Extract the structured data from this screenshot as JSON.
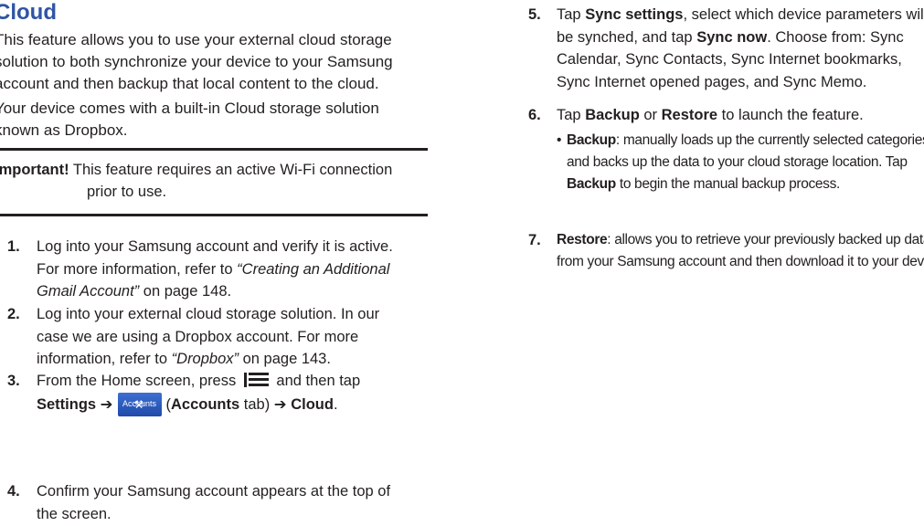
{
  "left": {
    "title": "Cloud",
    "intro_lines": [
      "This feature allows you to use your external cloud storage",
      "solution to both synchronize your device to your Samsung",
      "account and then backup that local content to the cloud."
    ],
    "dropbox_lines": [
      "Your device comes with a built-in Cloud storage solution",
      "known as Dropbox."
    ],
    "important_label": "Important!",
    "important_line1": "This feature requires an active Wi-Fi connection",
    "important_line2": "prior to use.",
    "steps": [
      {
        "num": "1.",
        "line1": "Log into your Samsung account and verify it is active.",
        "line2_pre": "For more information, refer to ",
        "line2_ref": "“Creating an Additional",
        "line3_ref": "Gmail Account”",
        "line3_post": "  on page 148."
      },
      {
        "num": "2.",
        "line1": "Log into your external cloud storage solution. In our",
        "line2": "case we are using a Dropbox account. For more",
        "line3_pre": "information, refer to ",
        "line3_ref": "“Dropbox”",
        "line3_post": "  on page 143."
      },
      {
        "num": "3.",
        "line1_pre": "From the Home screen, press ",
        "line1_post": " and then tap",
        "settings": "Settings ➔",
        "icon_label": "Accounts",
        "accounts_open": "(",
        "accounts_tab": "Accounts",
        "accounts_close": " tab) ➔ ",
        "cloud": "Cloud",
        "cloud_end": "."
      },
      {
        "num": "4.",
        "line1": "Confirm your Samsung account appears at the top of",
        "line2": "the screen."
      }
    ]
  },
  "right": {
    "step5": {
      "num": "5.",
      "l1_a": "Tap ",
      "l1_b": "Sync settings",
      "l1_c": ", select which device parameters will",
      "l2_a": "be synched, and tap ",
      "l2_b": "Sync now",
      "l2_c": ". Choose from: Sync",
      "l3": "Calendar, Sync Contacts, Sync Internet bookmarks,",
      "l4": "Sync Internet opened pages, and Sync Memo."
    },
    "step6": {
      "num": "6.",
      "l1_a": "Tap ",
      "l1_b": "Backup",
      "l1_c": " or ",
      "l1_d": "Restore",
      "l1_e": " to launch the feature.",
      "bullet": "•",
      "b1_a": "Backup",
      "b1_b": ": manually loads up the currently selected categories",
      "b2": "and backs up the data to your cloud storage location. Tap",
      "b3_a": "Backup",
      "b3_b": " to begin the manual backup process."
    },
    "step7": {
      "num": "7.",
      "l1_a": "Restore",
      "l1_b": ": allows you to retrieve your previously backed up data",
      "l2": "from your Samsung account and then download it to your device."
    }
  },
  "colors": {
    "title": "#2f55a4",
    "text": "#231f20",
    "icon_bg": "#2b59bd"
  },
  "icons": {
    "menu": "menu-key-icon",
    "accounts": "accounts-wrench-icon"
  }
}
